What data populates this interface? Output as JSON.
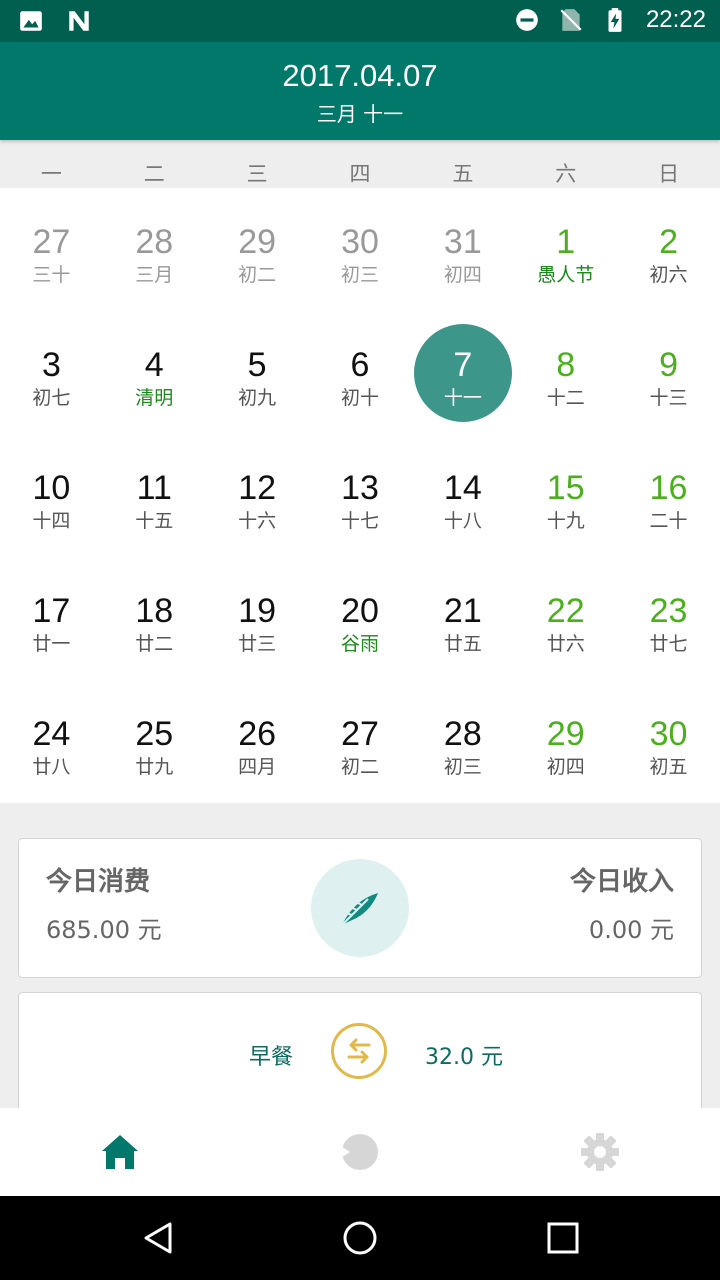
{
  "status_bar": {
    "time": "22:22",
    "left_icons": [
      "image-icon",
      "n-logo-icon"
    ],
    "right_icons": [
      "dnd-icon",
      "no-sim-icon",
      "battery-charging-icon"
    ]
  },
  "header": {
    "date": "2017.04.07",
    "lunar_date": "三月 十一"
  },
  "weekdays": [
    "一",
    "二",
    "三",
    "四",
    "五",
    "六",
    "日"
  ],
  "calendar": {
    "weeks": [
      [
        {
          "day": "27",
          "lunar": "三十",
          "state": "other"
        },
        {
          "day": "28",
          "lunar": "三月",
          "state": "other"
        },
        {
          "day": "29",
          "lunar": "初二",
          "state": "other"
        },
        {
          "day": "30",
          "lunar": "初三",
          "state": "other"
        },
        {
          "day": "31",
          "lunar": "初四",
          "state": "other"
        },
        {
          "day": "1",
          "lunar": "愚人节",
          "state": "weekend-festival"
        },
        {
          "day": "2",
          "lunar": "初六",
          "state": "weekend"
        }
      ],
      [
        {
          "day": "3",
          "lunar": "初七",
          "state": "cur"
        },
        {
          "day": "4",
          "lunar": "清明",
          "state": "festival"
        },
        {
          "day": "5",
          "lunar": "初九",
          "state": "cur"
        },
        {
          "day": "6",
          "lunar": "初十",
          "state": "cur"
        },
        {
          "day": "7",
          "lunar": "十一",
          "state": "selected"
        },
        {
          "day": "8",
          "lunar": "十二",
          "state": "weekend"
        },
        {
          "day": "9",
          "lunar": "十三",
          "state": "weekend"
        }
      ],
      [
        {
          "day": "10",
          "lunar": "十四",
          "state": "cur"
        },
        {
          "day": "11",
          "lunar": "十五",
          "state": "cur"
        },
        {
          "day": "12",
          "lunar": "十六",
          "state": "cur"
        },
        {
          "day": "13",
          "lunar": "十七",
          "state": "cur"
        },
        {
          "day": "14",
          "lunar": "十八",
          "state": "cur"
        },
        {
          "day": "15",
          "lunar": "十九",
          "state": "weekend"
        },
        {
          "day": "16",
          "lunar": "二十",
          "state": "weekend"
        }
      ],
      [
        {
          "day": "17",
          "lunar": "廿一",
          "state": "cur"
        },
        {
          "day": "18",
          "lunar": "廿二",
          "state": "cur"
        },
        {
          "day": "19",
          "lunar": "廿三",
          "state": "cur"
        },
        {
          "day": "20",
          "lunar": "谷雨",
          "state": "festival"
        },
        {
          "day": "21",
          "lunar": "廿五",
          "state": "cur"
        },
        {
          "day": "22",
          "lunar": "廿六",
          "state": "weekend"
        },
        {
          "day": "23",
          "lunar": "廿七",
          "state": "weekend"
        }
      ],
      [
        {
          "day": "24",
          "lunar": "廿八",
          "state": "cur"
        },
        {
          "day": "25",
          "lunar": "廿九",
          "state": "cur"
        },
        {
          "day": "26",
          "lunar": "四月",
          "state": "cur"
        },
        {
          "day": "27",
          "lunar": "初二",
          "state": "cur"
        },
        {
          "day": "28",
          "lunar": "初三",
          "state": "cur"
        },
        {
          "day": "29",
          "lunar": "初四",
          "state": "weekend"
        },
        {
          "day": "30",
          "lunar": "初五",
          "state": "weekend"
        }
      ]
    ]
  },
  "summary": {
    "expense_label": "今日消费",
    "expense_value": "685.00 元",
    "income_label": "今日收入",
    "income_value": "0.00  元",
    "center_icon": "feather-icon"
  },
  "record": {
    "name": "早餐",
    "amount": "32.0 元",
    "icon": "exchange-arrows-icon"
  },
  "tabs": [
    {
      "name": "home",
      "icon": "home-icon",
      "active": true
    },
    {
      "name": "chart",
      "icon": "pie-icon",
      "active": false
    },
    {
      "name": "settings",
      "icon": "gear-icon",
      "active": false
    }
  ],
  "colors": {
    "primary": "#00796b",
    "primary_dark": "#005f4e",
    "selected": "#3d968a",
    "weekend": "#4caf1e",
    "festival": "#1b8a1b"
  }
}
